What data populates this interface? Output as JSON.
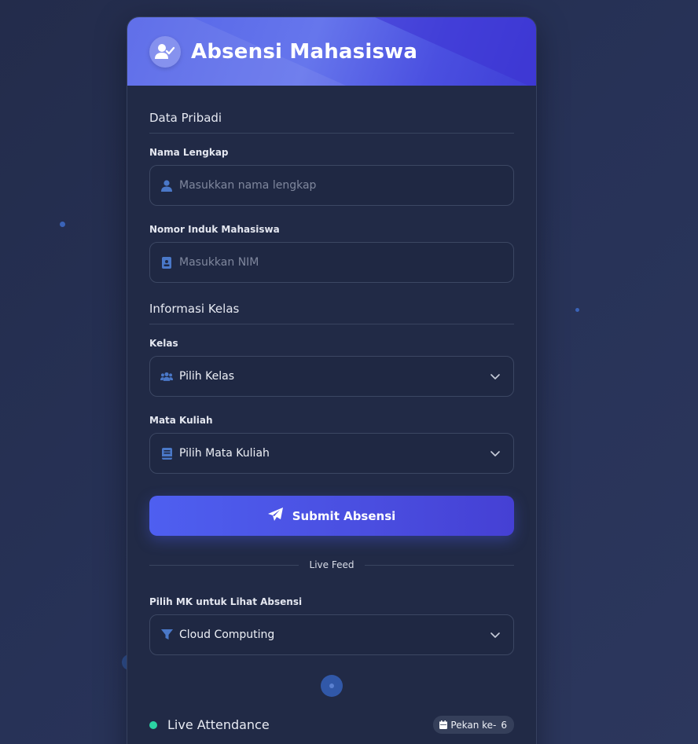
{
  "header": {
    "title": "Absensi Mahasiswa",
    "icon": "user-check-icon"
  },
  "sections": {
    "personal": "Data Pribadi",
    "class_info": "Informasi Kelas"
  },
  "fields": {
    "name": {
      "label": "Nama Lengkap",
      "placeholder": "Masukkan nama lengkap",
      "icon": "user-icon"
    },
    "nim": {
      "label": "Nomor Induk Mahasiswa",
      "placeholder": "Masukkan NIM",
      "icon": "id-card-icon"
    },
    "kelas": {
      "label": "Kelas",
      "value": "Pilih Kelas",
      "icon": "users-icon"
    },
    "matkul": {
      "label": "Mata Kuliah",
      "value": "Pilih Mata Kuliah",
      "icon": "book-icon"
    }
  },
  "submit": {
    "label": "Submit Absensi",
    "icon": "paper-plane-icon"
  },
  "live_feed": {
    "divider_label": "Live Feed",
    "filter_label": "Pilih MK untuk Lihat Absensi",
    "filter_value": "Cloud Computing",
    "title": "Live Attendance",
    "week_label": "Pekan ke-",
    "week_number": "6"
  },
  "colors": {
    "background": "#273257",
    "card": "#212a46",
    "accent": "#4e5ff0",
    "icon_blue": "#4a78c8",
    "live_green": "#2bd4a4"
  }
}
